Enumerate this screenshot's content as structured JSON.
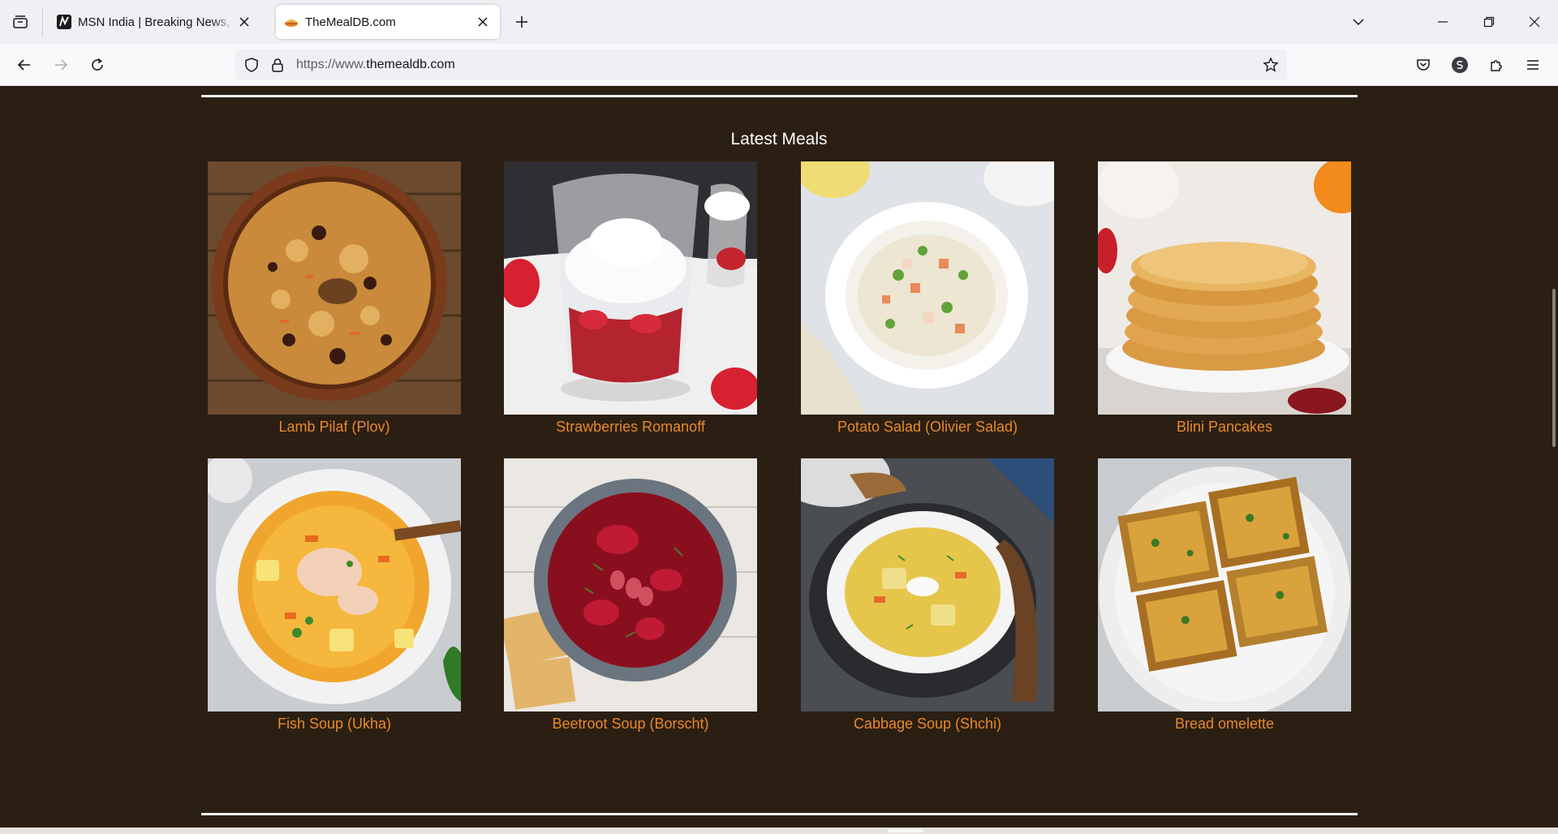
{
  "browser": {
    "tabs": [
      {
        "title": "MSN India | Breaking News, Entertainment",
        "active": false,
        "favicon": "msn-icon"
      },
      {
        "title": "TheMealDB.com",
        "active": true,
        "favicon": "mealdb-icon"
      }
    ],
    "url_prefix": "https://www.",
    "url_domain": "themealdb.com",
    "colors": {
      "tab_bar": "#f0f0f4",
      "nav_bar": "#f9f9fb",
      "url_bar": "#f0f0f4"
    }
  },
  "page": {
    "colors": {
      "background": "#2b1f13",
      "meal_link": "#e8892b",
      "title": "#ffffff",
      "divider": "#f2f2f2"
    },
    "section_title": "Latest Meals",
    "meals": [
      {
        "name": "Lamb Pilaf (Plov)",
        "image": "lamb-pilaf-photo"
      },
      {
        "name": "Strawberries Romanoff",
        "image": "strawberries-romanoff-photo"
      },
      {
        "name": "Potato Salad (Olivier Salad)",
        "image": "olivier-salad-photo"
      },
      {
        "name": "Blini Pancakes",
        "image": "blini-pancakes-photo"
      },
      {
        "name": "Fish Soup (Ukha)",
        "image": "ukha-fish-soup-photo"
      },
      {
        "name": "Beetroot Soup (Borscht)",
        "image": "borscht-photo"
      },
      {
        "name": "Cabbage Soup (Shchi)",
        "image": "shchi-photo"
      },
      {
        "name": "Bread omelette",
        "image": "bread-omelette-photo"
      }
    ]
  }
}
